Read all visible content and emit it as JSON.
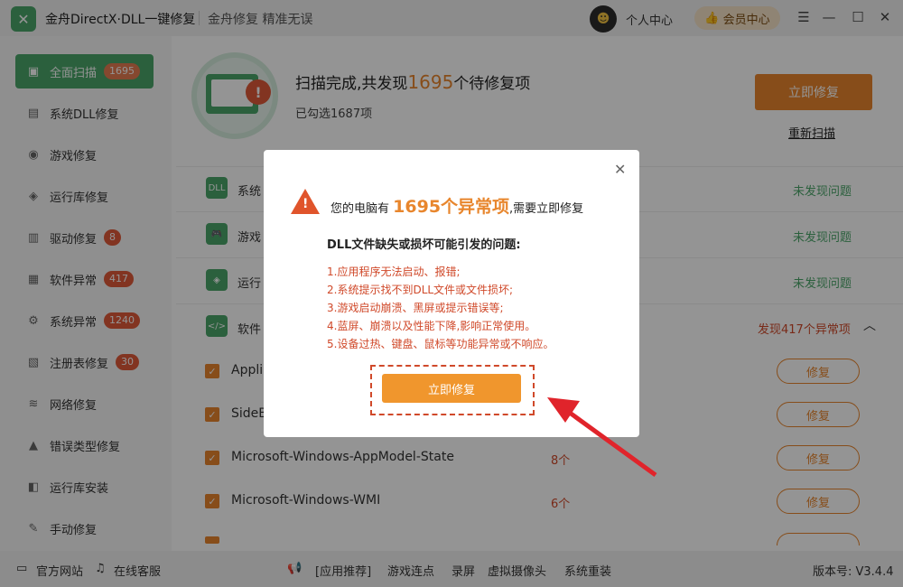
{
  "app": {
    "logo_glyph": "✕",
    "title": "金舟DirectX·DLL一键修复",
    "slogan": "金舟修复 精准无误"
  },
  "header": {
    "user_center": "个人中心",
    "vip_label": "会员中心",
    "vip_icon": "thumbs-up-icon",
    "controls": [
      "☰",
      "—",
      "☐",
      "✕"
    ]
  },
  "sidebar": {
    "items": [
      {
        "label": "全面扫描",
        "badge": "1695",
        "icon": "scan-icon",
        "glyph": "▣"
      },
      {
        "label": "系统DLL修复",
        "badge": "",
        "icon": "dll-icon",
        "glyph": "▤"
      },
      {
        "label": "游戏修复",
        "badge": "",
        "icon": "gamepad-icon",
        "glyph": "◉"
      },
      {
        "label": "运行库修复",
        "badge": "",
        "icon": "runtime-icon",
        "glyph": "◈"
      },
      {
        "label": "驱动修复",
        "badge": "8",
        "icon": "driver-icon",
        "glyph": "▥"
      },
      {
        "label": "软件异常",
        "badge": "417",
        "icon": "software-icon",
        "glyph": "▦"
      },
      {
        "label": "系统异常",
        "badge": "1240",
        "icon": "system-gear-icon",
        "glyph": "⚙"
      },
      {
        "label": "注册表修复",
        "badge": "30",
        "icon": "registry-icon",
        "glyph": "▧"
      },
      {
        "label": "网络修复",
        "badge": "",
        "icon": "wifi-icon",
        "glyph": "≋"
      },
      {
        "label": "错误类型修复",
        "badge": "",
        "icon": "warning-icon",
        "glyph": "▲"
      },
      {
        "label": "运行库安装",
        "badge": "",
        "icon": "install-icon",
        "glyph": "◧"
      },
      {
        "label": "手动修复",
        "badge": "",
        "icon": "wrench-icon",
        "glyph": "✎"
      }
    ]
  },
  "main": {
    "summary_prefix": "扫描完成,共发现",
    "summary_count": "1695",
    "summary_suffix": "个待修复项",
    "selected": "已勾选1687项",
    "fix_now": "立即修复",
    "rescan": "重新扫描",
    "categories": [
      {
        "name": "系统",
        "status": "未发现问题",
        "icon": "DLL"
      },
      {
        "name": "游戏",
        "status": "未发现问题",
        "icon": "🎮"
      },
      {
        "name": "运行",
        "status": "未发现问题",
        "icon": "◈"
      },
      {
        "name": "软件",
        "status": "发现417个异常项",
        "icon": "</>"
      }
    ],
    "items": [
      {
        "name": "Appli",
        "count": ""
      },
      {
        "name": "SideB",
        "count": ""
      },
      {
        "name": "Microsoft-Windows-AppModel-State",
        "count": "8个"
      },
      {
        "name": "Microsoft-Windows-WMI",
        "count": "6个"
      }
    ],
    "repair_label": "修复"
  },
  "dialog": {
    "headline_prefix": "您的电脑有",
    "headline_count": "1695个异常项",
    "headline_suffix": ",需要立即修复",
    "subhead": "DLL文件缺失或损坏可能引发的问题:",
    "problems": [
      "1.应用程序无法启动、报错;",
      "2.系统提示找不到DLL文件或文件损坏;",
      "3.游戏启动崩溃、黑屏或提示错误等;",
      "4.蓝屏、崩溃以及性能下降,影响正常使用。",
      "5.设备过热、键盘、鼠标等功能异常或不响应。"
    ],
    "button": "立即修复",
    "close": "✕"
  },
  "footer": {
    "website": "官方网站",
    "service": "在线客服",
    "recommend": "[应用推荐]",
    "links": [
      "游戏连点",
      "录屏",
      "虚拟摄像头",
      "系统重装"
    ],
    "version": "版本号: V3.4.4"
  }
}
